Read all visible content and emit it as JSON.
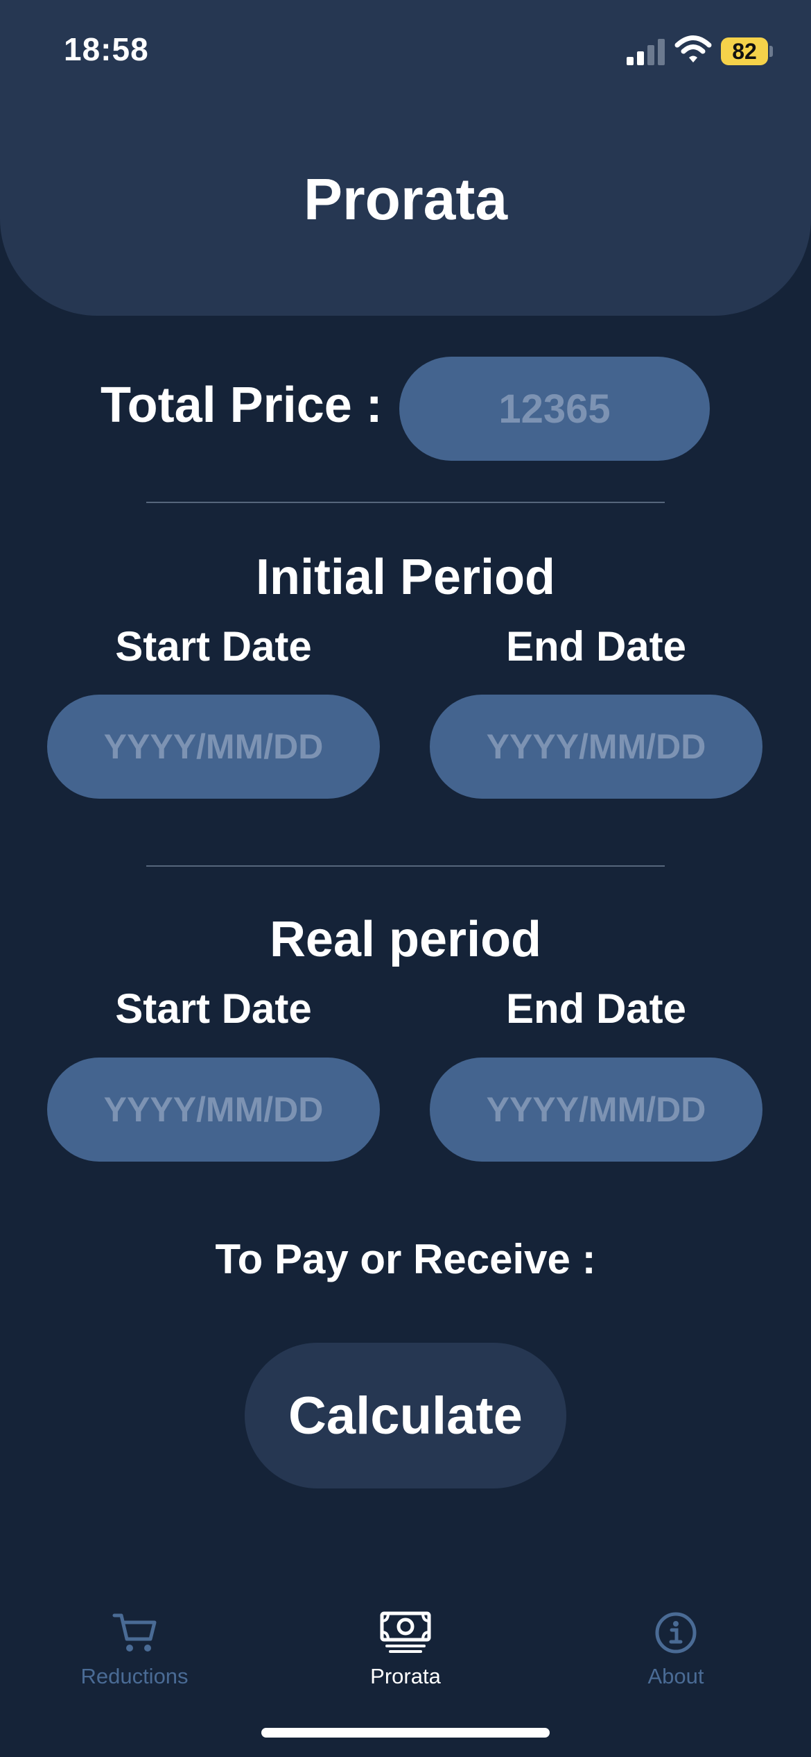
{
  "status_bar": {
    "time": "18:58",
    "battery_level": "82",
    "signal_icon": "cellular-signal-icon",
    "wifi_icon": "wifi-icon"
  },
  "header": {
    "title": "Prorata"
  },
  "total_price": {
    "label": "Total Price :",
    "placeholder": "12365"
  },
  "initial_period": {
    "title": "Initial Period",
    "start_label": "Start Date",
    "end_label": "End Date",
    "start_placeholder": "YYYY/MM/DD",
    "end_placeholder": "YYYY/MM/DD"
  },
  "real_period": {
    "title": "Real period",
    "start_label": "Start Date",
    "end_label": "End Date",
    "start_placeholder": "YYYY/MM/DD",
    "end_placeholder": "YYYY/MM/DD"
  },
  "result": {
    "label": "To Pay or Receive :"
  },
  "actions": {
    "calculate_label": "Calculate"
  },
  "tabbar": {
    "tabs": [
      {
        "label": "Reductions",
        "icon": "cart-icon",
        "active": false
      },
      {
        "label": "Prorata",
        "icon": "banknote-icon",
        "active": true
      },
      {
        "label": "About",
        "icon": "info-icon",
        "active": false
      }
    ]
  },
  "colors": {
    "background": "#152338",
    "header": "#263752",
    "input_fill": "#44648f",
    "tab_inactive": "#4a6b95",
    "battery": "#f5d24a"
  }
}
